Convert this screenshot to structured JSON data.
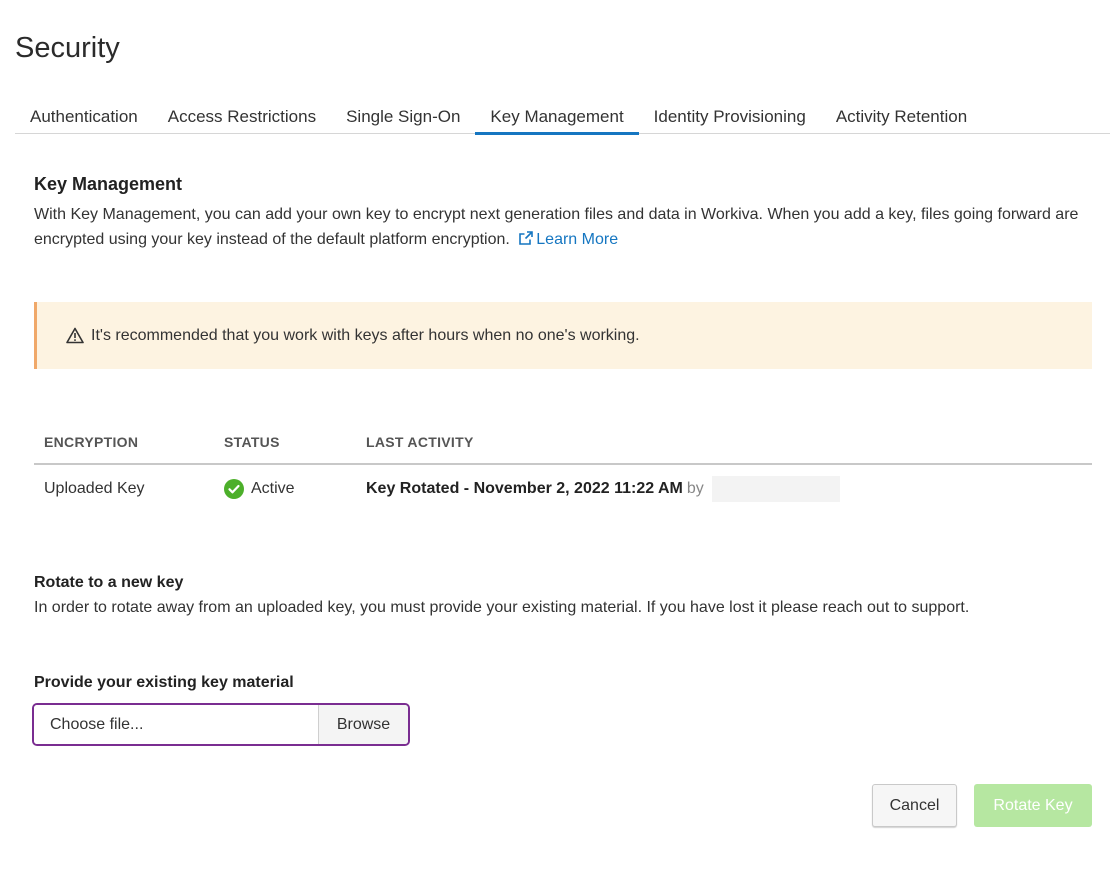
{
  "page": {
    "title": "Security"
  },
  "tabs": [
    {
      "label": "Authentication",
      "active": false
    },
    {
      "label": "Access Restrictions",
      "active": false
    },
    {
      "label": "Single Sign-On",
      "active": false
    },
    {
      "label": "Key Management",
      "active": true
    },
    {
      "label": "Identity Provisioning",
      "active": false
    },
    {
      "label": "Activity Retention",
      "active": false
    }
  ],
  "key_management": {
    "title": "Key Management",
    "description": "With Key Management, you can add your own key to encrypt next generation files and data in Workiva. When you add a key, files going forward are encrypted using your key instead of the default platform encryption.",
    "learn_more_label": "Learn More",
    "learn_more_icon": "external-link-icon"
  },
  "alert": {
    "icon": "warning-triangle-icon",
    "text": "It's recommended that you work with keys after hours when no one's working.",
    "background": "#fdf3e1",
    "accent": "#f0a869"
  },
  "table": {
    "headers": {
      "encryption": "ENCRYPTION",
      "status": "STATUS",
      "last_activity": "LAST ACTIVITY"
    },
    "rows": [
      {
        "encryption": "Uploaded Key",
        "status": "Active",
        "status_icon": "check-circle-icon",
        "status_color": "#4caf2a",
        "last_activity": "Key Rotated - November 2, 2022 11:22 AM",
        "by_label": "by"
      }
    ]
  },
  "rotate": {
    "title": "Rotate to a new key",
    "description": "In order to rotate away from an uploaded key, you must provide your existing material. If you have lost it please reach out to support."
  },
  "file_input": {
    "label": "Provide your existing key material",
    "placeholder": "Choose file...",
    "browse_label": "Browse",
    "focus_color": "#7a2d91"
  },
  "actions": {
    "cancel_label": "Cancel",
    "rotate_label": "Rotate Key",
    "rotate_color": "#b6e7a1"
  },
  "colors": {
    "link": "#1576c1",
    "active_tab": "#1576c1"
  }
}
